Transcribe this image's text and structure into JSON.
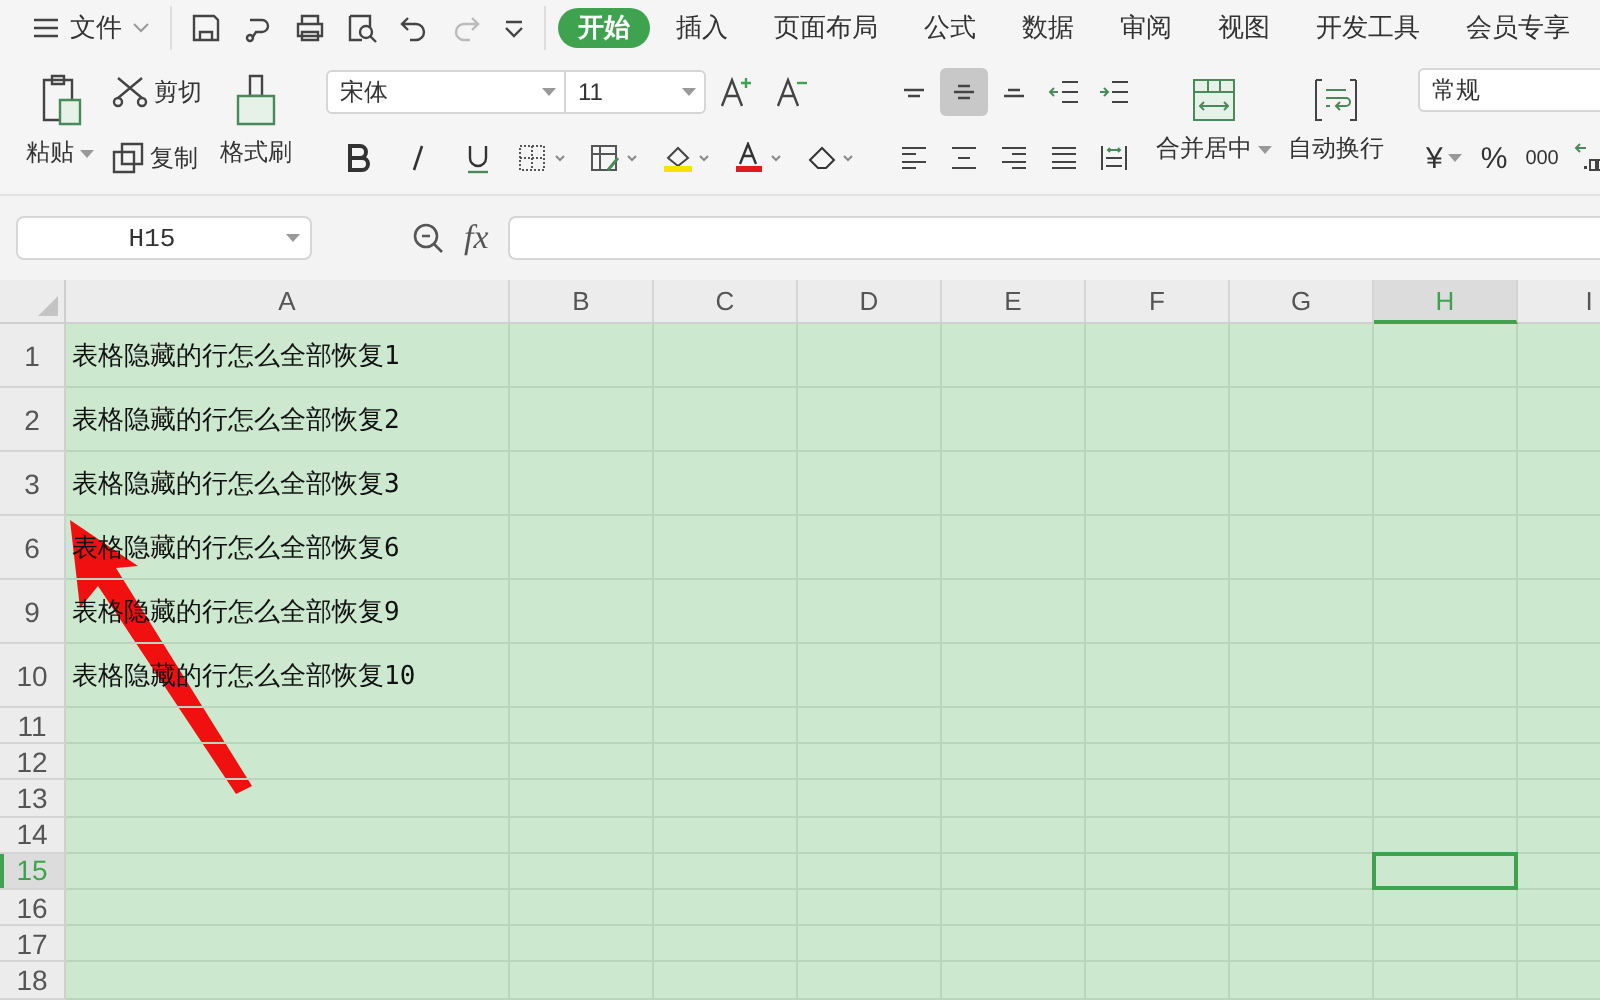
{
  "menu": {
    "file": "文件",
    "tabs": [
      {
        "label": "开始",
        "selected": true
      },
      {
        "label": "插入",
        "selected": false
      },
      {
        "label": "页面布局",
        "selected": false
      },
      {
        "label": "公式",
        "selected": false
      },
      {
        "label": "数据",
        "selected": false
      },
      {
        "label": "审阅",
        "selected": false
      },
      {
        "label": "视图",
        "selected": false
      },
      {
        "label": "开发工具",
        "selected": false
      },
      {
        "label": "会员专享",
        "selected": false
      }
    ]
  },
  "ribbon": {
    "paste": "粘贴",
    "cut": "剪切",
    "copy": "复制",
    "format_painter": "格式刷",
    "font": "宋体",
    "font_size": "11",
    "align_buttons": [
      {
        "kind": "top",
        "selected": false
      },
      {
        "kind": "middle",
        "selected": true
      },
      {
        "kind": "bottom",
        "selected": false
      }
    ],
    "merge": "合并居中",
    "wrap": "自动换行",
    "number_format": "常规",
    "currency": "¥",
    "percent": "%",
    "thousands": "000"
  },
  "formula_bar": {
    "name_box": "H15",
    "fx": "fx"
  },
  "sheet": {
    "columns": [
      {
        "label": "A",
        "selected": false
      },
      {
        "label": "B",
        "selected": false
      },
      {
        "label": "C",
        "selected": false
      },
      {
        "label": "D",
        "selected": false
      },
      {
        "label": "E",
        "selected": false
      },
      {
        "label": "F",
        "selected": false
      },
      {
        "label": "G",
        "selected": false
      },
      {
        "label": "H",
        "selected": true
      },
      {
        "label": "I",
        "selected": false
      }
    ],
    "rows": [
      {
        "label": "1",
        "cell_a": "表格隐藏的行怎么全部恢复1",
        "selected": false
      },
      {
        "label": "2",
        "cell_a": "表格隐藏的行怎么全部恢复2",
        "selected": false
      },
      {
        "label": "3",
        "cell_a": "表格隐藏的行怎么全部恢复3",
        "selected": false
      },
      {
        "label": "6",
        "cell_a": "表格隐藏的行怎么全部恢复6",
        "selected": false
      },
      {
        "label": "9",
        "cell_a": "表格隐藏的行怎么全部恢复9",
        "selected": false
      },
      {
        "label": "10",
        "cell_a": "表格隐藏的行怎么全部恢复10",
        "selected": false
      },
      {
        "label": "11",
        "selected": false
      },
      {
        "label": "12",
        "selected": false
      },
      {
        "label": "13",
        "selected": false
      },
      {
        "label": "14",
        "selected": false
      },
      {
        "label": "15",
        "selected": true
      },
      {
        "label": "16",
        "selected": false
      },
      {
        "label": "17",
        "selected": false
      },
      {
        "label": "18",
        "selected": false
      }
    ]
  }
}
